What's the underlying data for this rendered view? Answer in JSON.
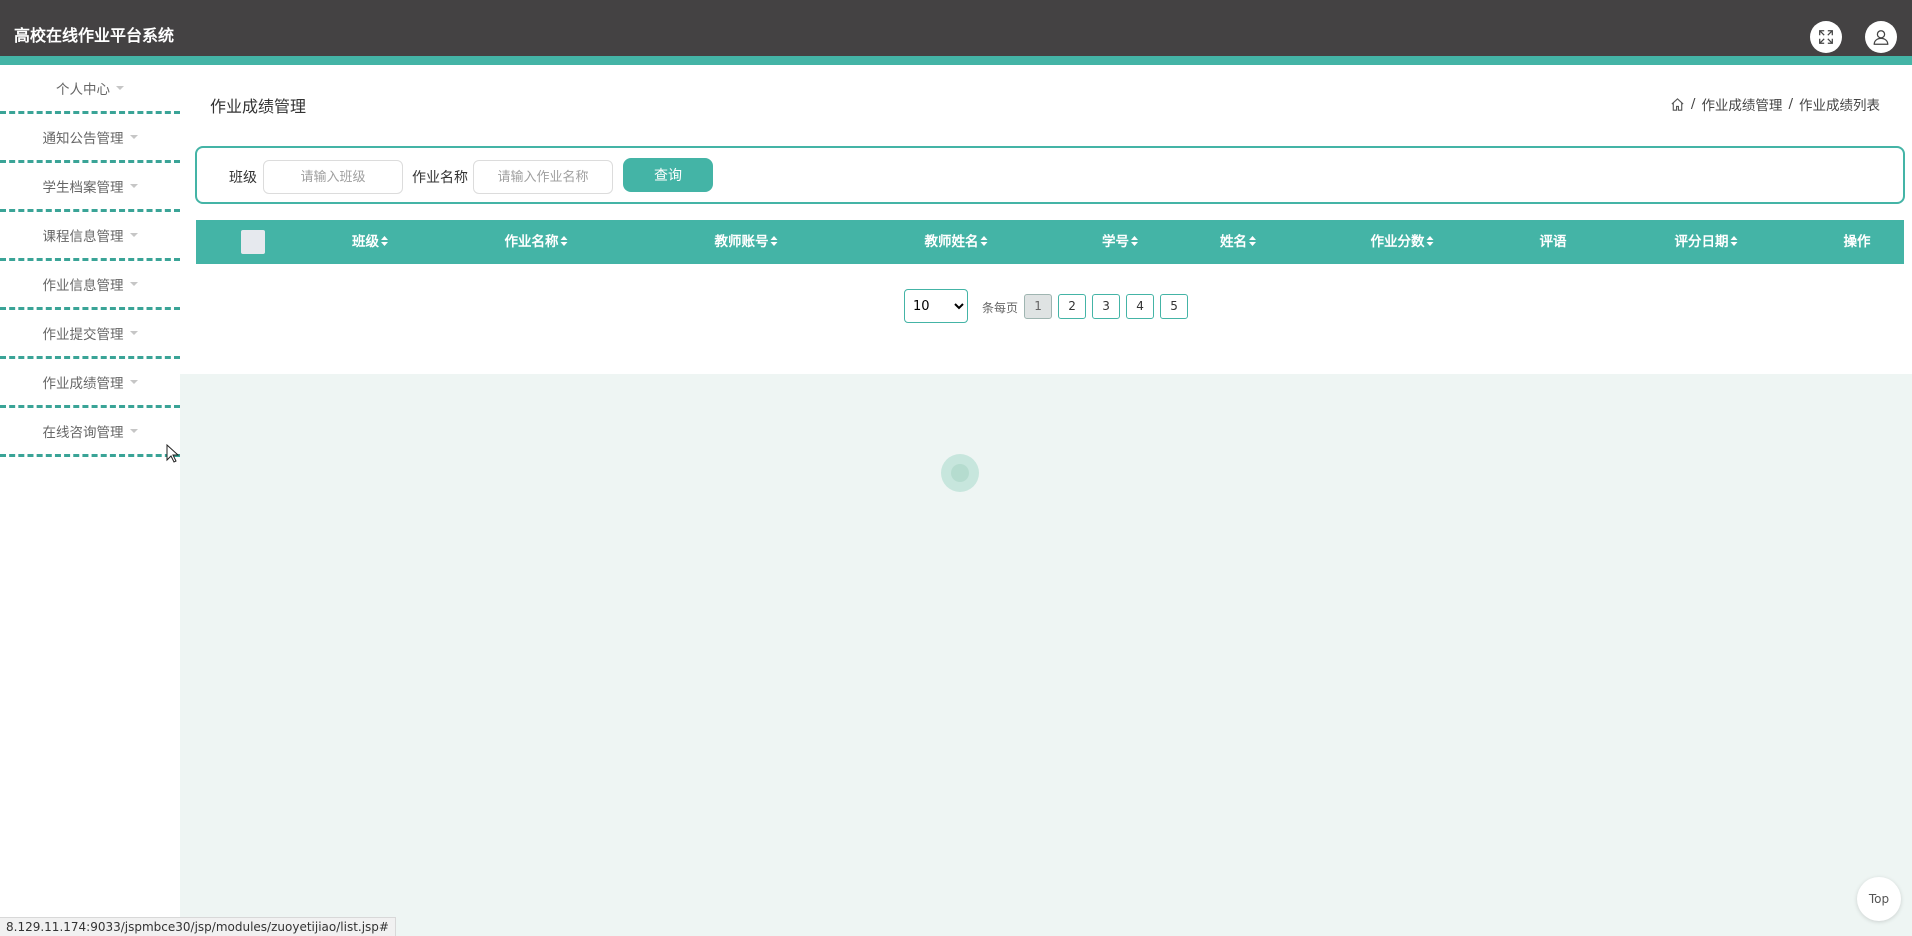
{
  "app": {
    "title": "高校在线作业平台系统"
  },
  "header": {
    "fullscreen_icon": "fullscreen-icon",
    "user_icon": "user-icon"
  },
  "sidebar": {
    "items": [
      {
        "label": "个人中心"
      },
      {
        "label": "通知公告管理"
      },
      {
        "label": "学生档案管理"
      },
      {
        "label": "课程信息管理"
      },
      {
        "label": "作业信息管理"
      },
      {
        "label": "作业提交管理"
      },
      {
        "label": "作业成绩管理"
      },
      {
        "label": "在线咨询管理"
      }
    ]
  },
  "page": {
    "title": "作业成绩管理",
    "breadcrumb": {
      "home_icon": "home-icon",
      "items": [
        "作业成绩管理",
        "作业成绩列表"
      ],
      "separator": "/"
    }
  },
  "search": {
    "class_label": "班级",
    "class_placeholder": "请输入班级",
    "homework_label": "作业名称",
    "homework_placeholder": "请输入作业名称",
    "button": "查询"
  },
  "table": {
    "columns": [
      "班级",
      "作业名称",
      "教师账号",
      "教师姓名",
      "学号",
      "姓名",
      "作业分数",
      "评语",
      "评分日期",
      "操作"
    ],
    "rows": []
  },
  "pagination": {
    "page_size": "10",
    "per_page_label": "条每页",
    "pages": [
      "1",
      "2",
      "3",
      "4",
      "5"
    ],
    "current": "1"
  },
  "status_bar": {
    "url": "8.129.11.174:9033/jspmbce30/jsp/modules/zuoyetijiao/list.jsp#"
  },
  "back_to_top": "Top",
  "colors": {
    "accent": "#44b4a6",
    "topbar": "#444243",
    "content_bg": "#eef5f3"
  }
}
